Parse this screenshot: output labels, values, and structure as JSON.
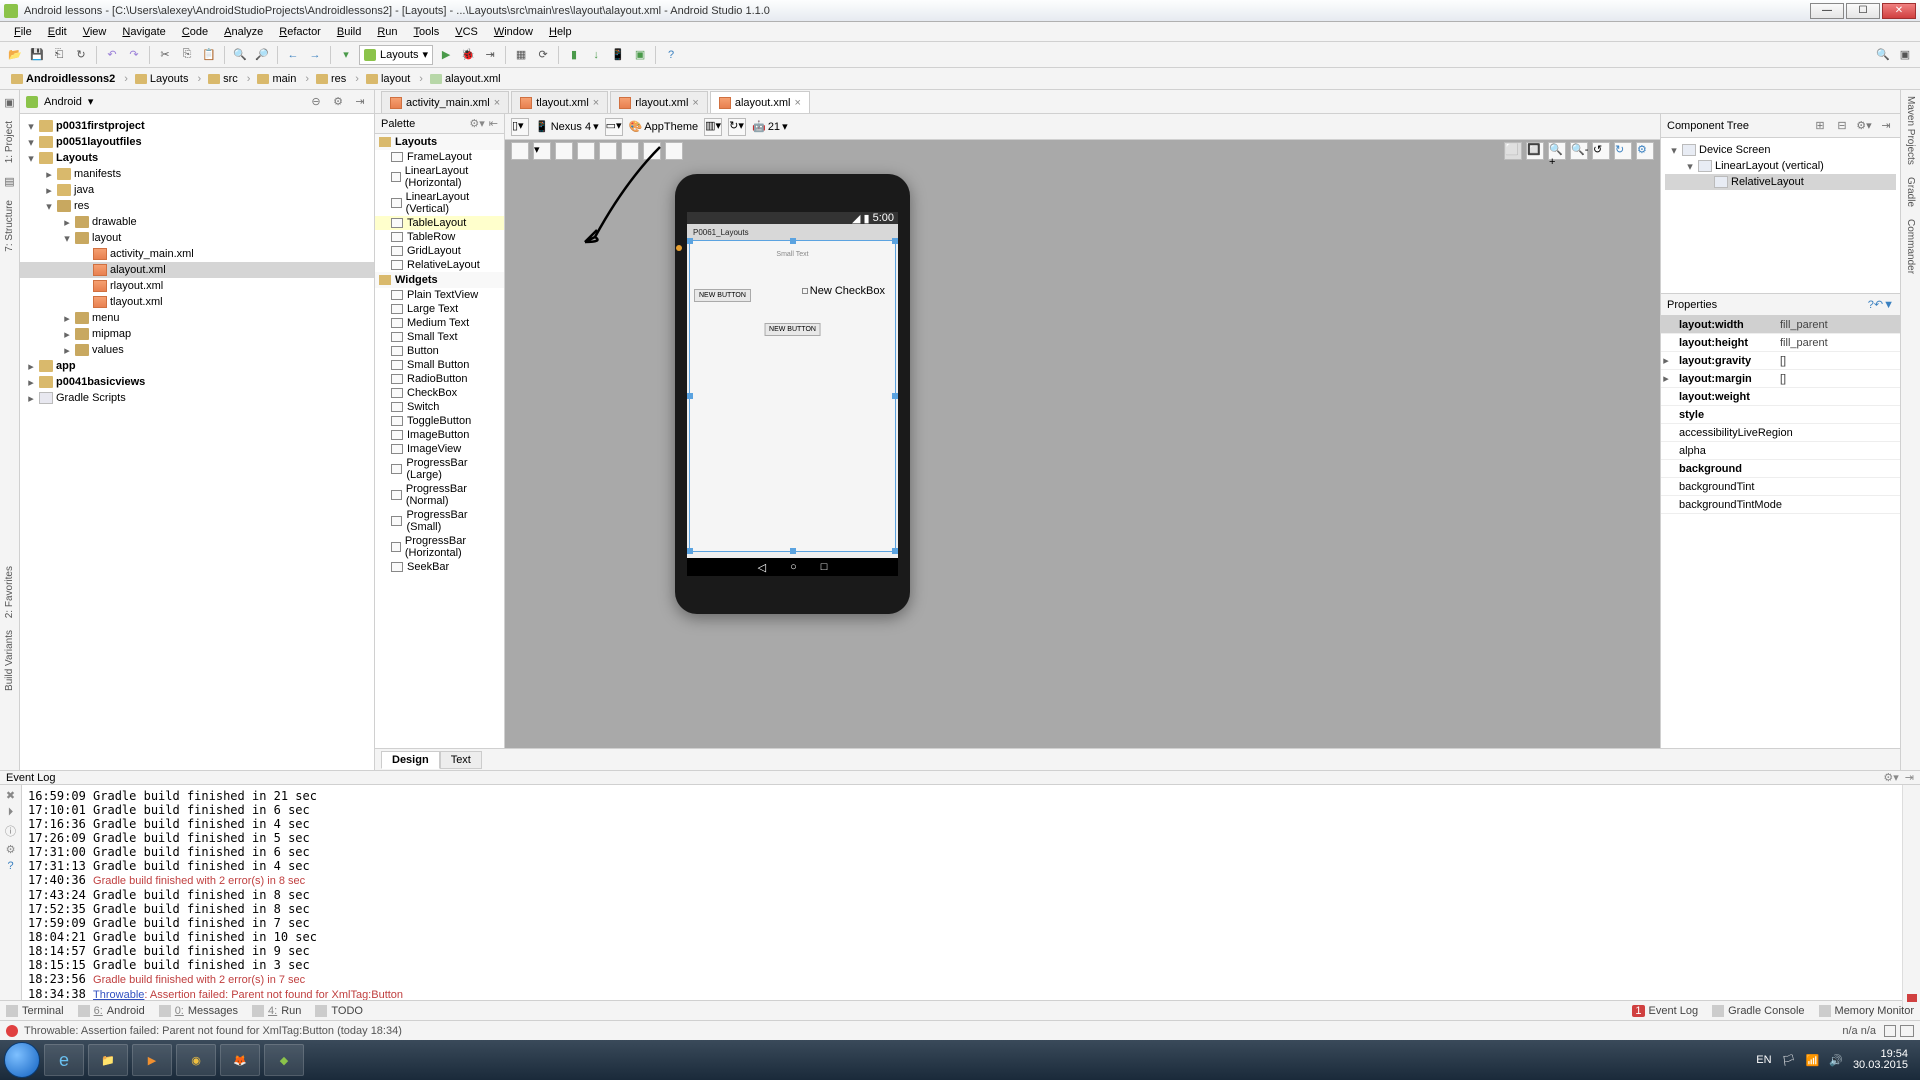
{
  "titlebar": {
    "title": "Android lessons - [C:\\Users\\alexey\\AndroidStudioProjects\\Androidlessons2] - [Layouts] - ...\\Layouts\\src\\main\\res\\layout\\alayout.xml - Android Studio 1.1.0"
  },
  "menu": [
    "File",
    "Edit",
    "View",
    "Navigate",
    "Code",
    "Analyze",
    "Refactor",
    "Build",
    "Run",
    "Tools",
    "VCS",
    "Window",
    "Help"
  ],
  "toolbar_combo": "Layouts",
  "breadcrumb": [
    {
      "label": "Androidlessons2",
      "type": "folder",
      "bold": true
    },
    {
      "label": "Layouts",
      "type": "folder"
    },
    {
      "label": "src",
      "type": "folder"
    },
    {
      "label": "main",
      "type": "folder"
    },
    {
      "label": "res",
      "type": "folder"
    },
    {
      "label": "layout",
      "type": "folder"
    },
    {
      "label": "alayout.xml",
      "type": "file"
    }
  ],
  "left_tabs": [
    "1: Project",
    "7: Structure"
  ],
  "right_tabs": [
    "Maven Projects",
    "Gradle",
    "Commander"
  ],
  "project_panel": {
    "header_mode": "Android",
    "tree": [
      {
        "indent": 0,
        "arrow": "▾",
        "icon": "folder",
        "label": "p0031firstproject",
        "bold": true
      },
      {
        "indent": 0,
        "arrow": "▾",
        "icon": "folder",
        "label": "p0051layoutfiles",
        "bold": true
      },
      {
        "indent": 0,
        "arrow": "▾",
        "icon": "folder",
        "label": "Layouts",
        "bold": true
      },
      {
        "indent": 1,
        "arrow": "▸",
        "icon": "folder",
        "label": "manifests"
      },
      {
        "indent": 1,
        "arrow": "▸",
        "icon": "folder",
        "label": "java"
      },
      {
        "indent": 1,
        "arrow": "▾",
        "icon": "pkg",
        "label": "res"
      },
      {
        "indent": 2,
        "arrow": "▸",
        "icon": "pkg",
        "label": "drawable"
      },
      {
        "indent": 2,
        "arrow": "▾",
        "icon": "pkg",
        "label": "layout"
      },
      {
        "indent": 3,
        "arrow": "",
        "icon": "xml",
        "label": "activity_main.xml"
      },
      {
        "indent": 3,
        "arrow": "",
        "icon": "xml",
        "label": "alayout.xml",
        "sel": true
      },
      {
        "indent": 3,
        "arrow": "",
        "icon": "xml",
        "label": "rlayout.xml"
      },
      {
        "indent": 3,
        "arrow": "",
        "icon": "xml",
        "label": "tlayout.xml"
      },
      {
        "indent": 2,
        "arrow": "▸",
        "icon": "pkg",
        "label": "menu"
      },
      {
        "indent": 2,
        "arrow": "▸",
        "icon": "pkg",
        "label": "mipmap"
      },
      {
        "indent": 2,
        "arrow": "▸",
        "icon": "pkg",
        "label": "values"
      },
      {
        "indent": 0,
        "arrow": "▸",
        "icon": "folder",
        "label": "app",
        "bold": true
      },
      {
        "indent": 0,
        "arrow": "▸",
        "icon": "folder",
        "label": "p0041basicviews",
        "bold": true
      },
      {
        "indent": 0,
        "arrow": "▸",
        "icon": "file",
        "label": "Gradle Scripts"
      }
    ]
  },
  "editor_tabs": [
    {
      "label": "activity_main.xml"
    },
    {
      "label": "tlayout.xml"
    },
    {
      "label": "rlayout.xml"
    },
    {
      "label": "alayout.xml",
      "active": true
    }
  ],
  "palette": {
    "title": "Palette",
    "groups": [
      {
        "label": "Layouts",
        "items": [
          {
            "label": "FrameLayout"
          },
          {
            "label": "LinearLayout (Horizontal)"
          },
          {
            "label": "LinearLayout (Vertical)"
          },
          {
            "label": "TableLayout",
            "hl": true
          },
          {
            "label": "TableRow"
          },
          {
            "label": "GridLayout"
          },
          {
            "label": "RelativeLayout"
          }
        ]
      },
      {
        "label": "Widgets",
        "items": [
          {
            "label": "Plain TextView"
          },
          {
            "label": "Large Text"
          },
          {
            "label": "Medium Text"
          },
          {
            "label": "Small Text"
          },
          {
            "label": "Button"
          },
          {
            "label": "Small Button"
          },
          {
            "label": "RadioButton"
          },
          {
            "label": "CheckBox"
          },
          {
            "label": "Switch"
          },
          {
            "label": "ToggleButton"
          },
          {
            "label": "ImageButton"
          },
          {
            "label": "ImageView"
          },
          {
            "label": "ProgressBar (Large)"
          },
          {
            "label": "ProgressBar (Normal)"
          },
          {
            "label": "ProgressBar (Small)"
          },
          {
            "label": "ProgressBar (Horizontal)"
          },
          {
            "label": "SeekBar"
          }
        ]
      }
    ]
  },
  "design_tb": {
    "device": "Nexus 4",
    "theme": "AppTheme",
    "api": "21"
  },
  "device": {
    "status_time": "5:00",
    "app_title": "P0061_Layouts",
    "small_text": "Small Text",
    "btn1": "NEW BUTTON",
    "btn2": "NEW BUTTON",
    "cb": "New CheckBox"
  },
  "design_tabs": {
    "design": "Design",
    "text": "Text"
  },
  "component_tree": {
    "title": "Component Tree",
    "rows": [
      {
        "indent": 0,
        "arrow": "▾",
        "label": "Device Screen"
      },
      {
        "indent": 1,
        "arrow": "▾",
        "label": "LinearLayout (vertical)"
      },
      {
        "indent": 2,
        "arrow": "",
        "label": "RelativeLayout",
        "sel": true
      }
    ]
  },
  "properties": {
    "title": "Properties",
    "rows": [
      {
        "name": "layout:width",
        "val": "fill_parent",
        "sel": true,
        "bold": true
      },
      {
        "name": "layout:height",
        "val": "fill_parent",
        "bold": true
      },
      {
        "name": "layout:gravity",
        "val": "[]",
        "bold": true,
        "exp": true
      },
      {
        "name": "layout:margin",
        "val": "[]",
        "bold": true,
        "exp": true
      },
      {
        "name": "layout:weight",
        "val": "",
        "bold": true
      },
      {
        "name": "style",
        "val": "",
        "bold": true
      },
      {
        "name": "accessibilityLiveRegion",
        "val": ""
      },
      {
        "name": "alpha",
        "val": ""
      },
      {
        "name": "background",
        "val": "",
        "bold": true
      },
      {
        "name": "backgroundTint",
        "val": ""
      },
      {
        "name": "backgroundTintMode",
        "val": ""
      }
    ]
  },
  "event_log": {
    "title": "Event Log",
    "lines": [
      {
        "t": "16:59:09 Gradle build finished in 21 sec"
      },
      {
        "t": "17:10:01 Gradle build finished in 6 sec"
      },
      {
        "t": "17:16:36 Gradle build finished in 4 sec"
      },
      {
        "t": "17:26:09 Gradle build finished in 5 sec"
      },
      {
        "t": "17:31:00 Gradle build finished in 6 sec"
      },
      {
        "t": "17:31:13 Gradle build finished in 4 sec"
      },
      {
        "t": "17:40:36 ",
        "err": "Gradle build finished with 2 error(s) in 8 sec"
      },
      {
        "t": "17:43:24 Gradle build finished in 8 sec"
      },
      {
        "t": "17:52:35 Gradle build finished in 8 sec"
      },
      {
        "t": "17:59:09 Gradle build finished in 7 sec"
      },
      {
        "t": "18:04:21 Gradle build finished in 10 sec"
      },
      {
        "t": "18:14:57 Gradle build finished in 9 sec"
      },
      {
        "t": "18:15:15 Gradle build finished in 3 sec"
      },
      {
        "t": "18:23:56 ",
        "err": "Gradle build finished with 2 error(s) in 7 sec"
      },
      {
        "t": "18:34:38 ",
        "link": "Throwable",
        "rest": ": Assertion failed: Parent not found for XmlTag:Button"
      }
    ]
  },
  "bottom_tabs": [
    {
      "num": "",
      "label": "Terminal"
    },
    {
      "num": "6:",
      "label": "Android"
    },
    {
      "num": "0:",
      "label": "Messages"
    },
    {
      "num": "4:",
      "label": "Run"
    },
    {
      "num": "",
      "label": "TODO"
    }
  ],
  "bottom_tabs_right": [
    {
      "label": "Event Log",
      "badge": "1"
    },
    {
      "label": "Gradle Console"
    },
    {
      "label": "Memory Monitor"
    }
  ],
  "statusbar": {
    "msg": "Throwable: Assertion failed: Parent not found for XmlTag:Button (today 18:34)",
    "right": "n/a   n/a"
  },
  "tray": {
    "lang": "EN",
    "time": "19:54",
    "date": "30.03.2015"
  },
  "left_strip": [
    "2: Favorites",
    "Build Variants"
  ]
}
